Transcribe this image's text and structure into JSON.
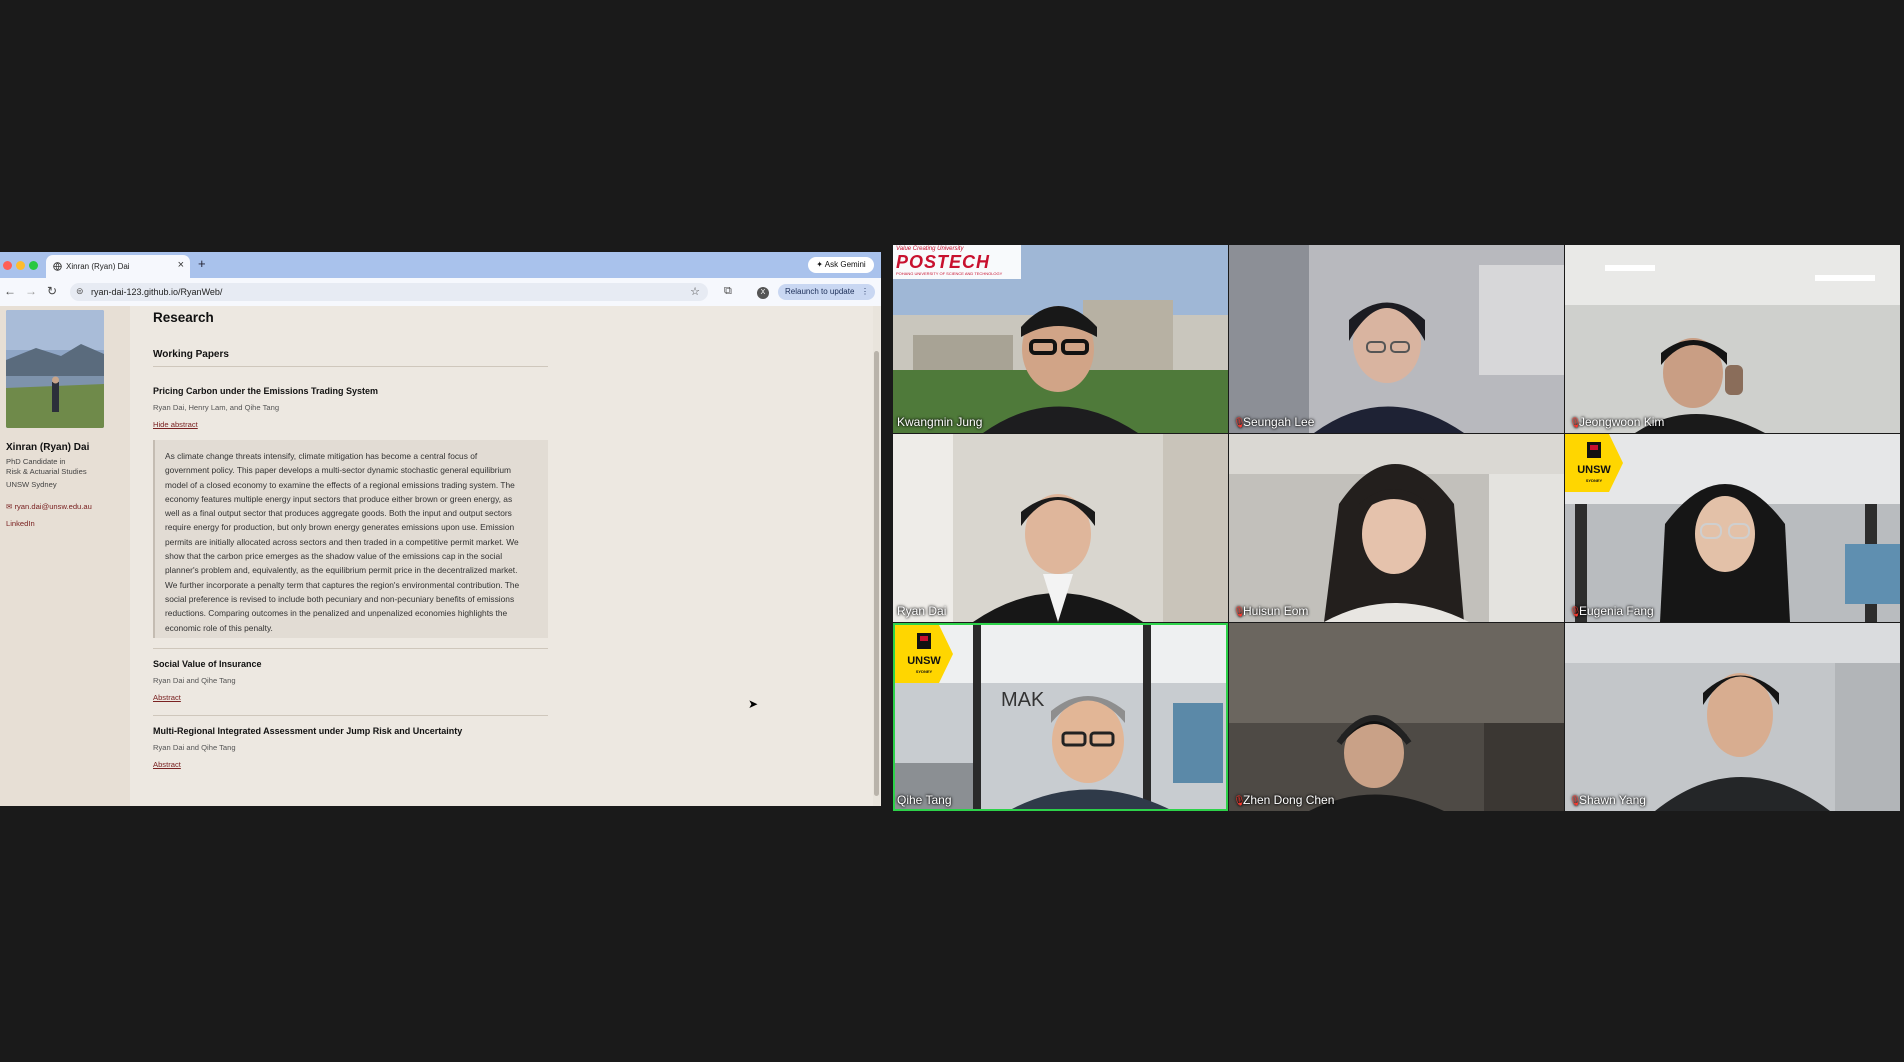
{
  "browser": {
    "tab_title": "Xinran (Ryan) Dai",
    "url": "ryan-dai-123.github.io/RyanWeb/",
    "ask_gemini": "Ask Gemini",
    "relaunch": "Relaunch to update",
    "profile_initial": "X"
  },
  "sidebar": {
    "name": "Xinran (Ryan) Dai",
    "role_line1": "PhD Candidate in",
    "role_line2": "Risk & Actuarial Studies",
    "institution": "UNSW Sydney",
    "email": "✉ ryan.dai@unsw.edu.au",
    "linkedin": "LinkedIn"
  },
  "research": {
    "heading": "Research",
    "subheading": "Working Papers",
    "papers": [
      {
        "title": "Pricing Carbon under the Emissions Trading System",
        "authors": "Ryan Dai, Henry Lam, and Qihe Tang",
        "link": "Hide abstract",
        "abstract_lines": [
          "As climate change threats intensify, climate mitigation has become a central focus of",
          "government policy. This paper develops a multi-sector dynamic stochastic general equilibrium",
          "model of a closed economy to examine the effects of a regional emissions trading system. The",
          "economy features multiple energy input sectors that produce either brown or green energy, as",
          "well as a final output sector that produces aggregate goods. Both the input and output sectors",
          "require energy for production, but only brown energy generates emissions upon use. Emission",
          "permits are initially allocated across sectors and then traded in a competitive permit market. We",
          "show that the carbon price emerges as the shadow value of the emissions cap in the social",
          "planner's problem and, equivalently, as the equilibrium permit price in the decentralized market.",
          "We further incorporate a penalty term that captures the region's environmental contribution. The",
          "social preference is revised to include both pecuniary and non-pecuniary benefits of emissions",
          "reductions. Comparing outcomes in the penalized and unpenalized economies highlights the",
          "economic role of this penalty."
        ]
      },
      {
        "title": "Social Value of Insurance",
        "authors": "Ryan Dai and Qihe Tang",
        "link": "Abstract"
      },
      {
        "title": "Multi-Regional Integrated Assessment under Jump Risk and Uncertainty",
        "authors": "Ryan Dai and Qihe Tang",
        "link": "Abstract"
      }
    ]
  },
  "video": {
    "participants": [
      {
        "name": "Kwangmin Jung",
        "muted": false
      },
      {
        "name": "Seungah Lee",
        "muted": true
      },
      {
        "name": "Jeongwoon Kim",
        "muted": true
      },
      {
        "name": "Ryan Dai",
        "muted": false
      },
      {
        "name": "Huisun Eom",
        "muted": true
      },
      {
        "name": "Eugenia Fang",
        "muted": true
      },
      {
        "name": "Qihe Tang",
        "muted": false,
        "speaking": true
      },
      {
        "name": "Zhen Dong Chen",
        "muted": true
      },
      {
        "name": "Shawn Yang",
        "muted": true
      }
    ],
    "postech_logo": "POSTECH",
    "postech_tagline": "Value Creating University",
    "postech_sub": "POHANG UNIVERSITY OF SCIENCE AND TECHNOLOGY",
    "unsw_logo": "UNSW",
    "unsw_sub": "SYDNEY",
    "bg_text": "MAK"
  },
  "colors": {
    "speaking_border": "#2dd24a",
    "muted_icon": "#ff3b30",
    "link": "#7a2222"
  }
}
